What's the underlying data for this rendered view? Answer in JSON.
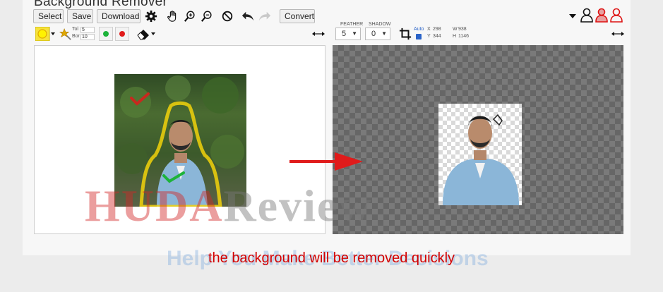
{
  "app": {
    "title": "Background Remover"
  },
  "toolbar": {
    "select_label": "Select",
    "save_label": "Save",
    "download_label": "Download",
    "convert_label": "Convert",
    "row2": {
      "tol_label": "Tol",
      "tol_value": "5",
      "bor_label": "Bor",
      "bor_value": "10"
    },
    "feather": {
      "label": "FEATHER",
      "value": "5"
    },
    "shadow": {
      "label": "SHADOW",
      "value": "0"
    },
    "crop": {
      "auto_label": "Auto",
      "x_label": "X",
      "x_value": "298",
      "y_label": "Y",
      "y_value": "344",
      "w_label": "W",
      "w_value": "938",
      "h_label": "H",
      "h_value": "1146"
    }
  },
  "caption": "the background will be removed quickly",
  "watermark": {
    "part1": "HUDA",
    "part2": "Review",
    "tagline": "Help You Make Better Decisions"
  },
  "colors": {
    "accent_red": "#e01b1b",
    "caption_red": "#d40000",
    "green_dot": "#1db33a",
    "yellow_outline": "#f2d20a"
  },
  "icons": [
    "gear-icon",
    "hand-icon",
    "zoom-in-icon",
    "zoom-out-icon",
    "no-icon",
    "undo-icon",
    "redo-icon",
    "dropdown-icon",
    "user-outline-icon",
    "user-red-icon",
    "user-red-outline-icon",
    "yellow-circle-icon",
    "magic-wand-icon",
    "green-dot-icon",
    "red-dot-icon",
    "eraser-icon",
    "expand-arrows-icon",
    "crop-icon"
  ]
}
